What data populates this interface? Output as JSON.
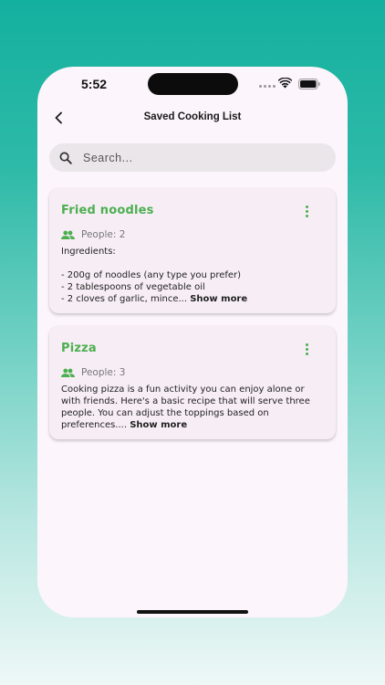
{
  "status_bar": {
    "time": "5:52"
  },
  "header": {
    "title": "Saved Cooking List",
    "back_icon": "chevron-left-icon"
  },
  "search": {
    "placeholder": "Search...",
    "icon": "search-icon"
  },
  "accent_color": "#4caf50",
  "recipes": [
    {
      "title": "Fried noodles",
      "people": "People: 2",
      "preview": "Ingredients:\n\n- 200g of noodles (any type you prefer)\n- 2 tablespoons of vegetable oil\n- 2 cloves of garlic, mince... ",
      "show_more": "Show more"
    },
    {
      "title": "Pizza",
      "people": "People: 3",
      "preview": "Cooking pizza is a fun activity you can enjoy alone or with friends. Here's a basic recipe that will serve three people. You can adjust the toppings based on preferences.... ",
      "show_more": "Show more"
    }
  ]
}
